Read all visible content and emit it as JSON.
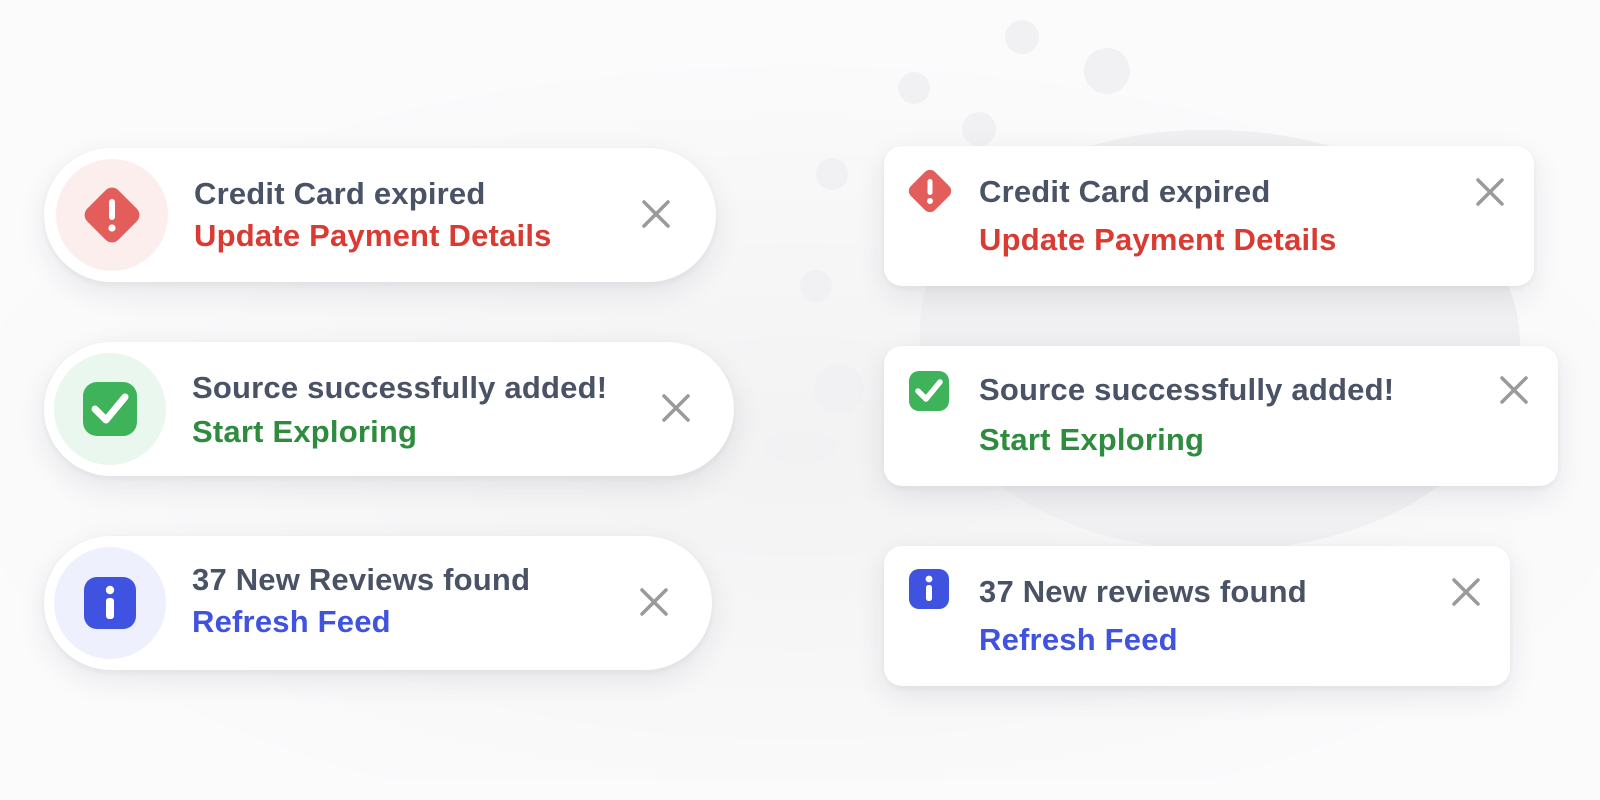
{
  "colors": {
    "error": "#e35d5a",
    "error_text": "#d93b33",
    "success": "#3fb35a",
    "success_text": "#2f8c3e",
    "info": "#3f53e0",
    "title_text": "#4a5266",
    "close_icon": "#9a9a9a"
  },
  "pill_toasts": [
    {
      "icon": "alert-diamond-icon",
      "title": "Credit Card expired",
      "action": "Update Payment Details"
    },
    {
      "icon": "check-square-icon",
      "title": "Source successfully added!",
      "action": "Start Exploring"
    },
    {
      "icon": "info-square-icon",
      "title": "37 New Reviews found",
      "action": "Refresh Feed"
    }
  ],
  "card_toasts": [
    {
      "icon": "alert-diamond-icon",
      "title": "Credit Card expired",
      "action": "Update Payment Details"
    },
    {
      "icon": "check-square-icon",
      "title": "Source successfully added!",
      "action": "Start Exploring"
    },
    {
      "icon": "info-square-icon",
      "title": "37 New reviews found",
      "action": "Refresh Feed"
    }
  ]
}
